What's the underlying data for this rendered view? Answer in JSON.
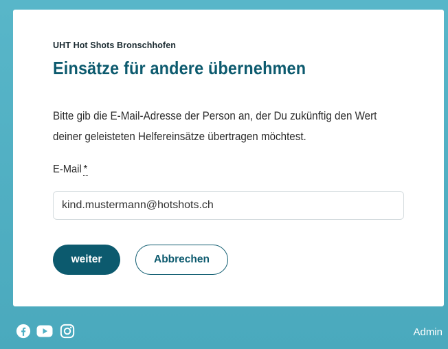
{
  "card": {
    "organization": "UHT Hot Shots Bronschhofen",
    "title": "Einsätze für andere übernehmen",
    "description": "Bitte gib die E-Mail-Adresse der Person an, der Du zukünftig den Wert deiner geleisteten Helfereinsätze übertragen möchtest.",
    "email_label": "E-Mail",
    "required_marker": "*",
    "email_value": "kind.mustermann@hotshots.ch",
    "submit_label": "weiter",
    "cancel_label": "Abbrechen"
  },
  "footer": {
    "social_icons": [
      "facebook-icon",
      "youtube-icon",
      "instagram-icon"
    ],
    "admin_label": "Admin"
  },
  "colors": {
    "accent": "#0c5a6e",
    "background": "#4fb0c4",
    "card": "#ffffff"
  }
}
